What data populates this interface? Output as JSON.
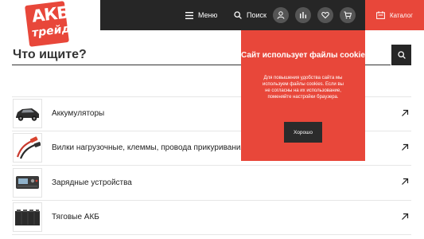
{
  "header": {
    "logo_top": "АКБ",
    "logo_bottom": "трейд",
    "menu_label": "Меню",
    "search_label": "Поиск",
    "catalog_label": "Каталог",
    "icons": [
      "menu-icon",
      "search-icon",
      "user-icon",
      "compare-icon",
      "heart-icon",
      "cart-icon",
      "catalog-icon"
    ]
  },
  "search": {
    "placeholder": "Что ищите?"
  },
  "categories": [
    {
      "label": "Аккумуляторы",
      "icon": "car-thumbnail"
    },
    {
      "label": "Вилки нагрузочные, клеммы, провода прикуривания",
      "icon": "jumper-cables-thumbnail"
    },
    {
      "label": "Зарядные устройства",
      "icon": "charger-thumbnail"
    },
    {
      "label": "Тяговые АКБ",
      "icon": "traction-battery-thumbnail"
    }
  ],
  "cookie": {
    "title": "Сайт использует файлы cookie",
    "text": "Для повышения удобства сайта мы используем файлы cookies. Если вы не согласны на их использование, поменяйте настройки браузера.",
    "button": "Хорошо"
  },
  "colors": {
    "brand_red": "#e8473a",
    "dark": "#262626"
  }
}
